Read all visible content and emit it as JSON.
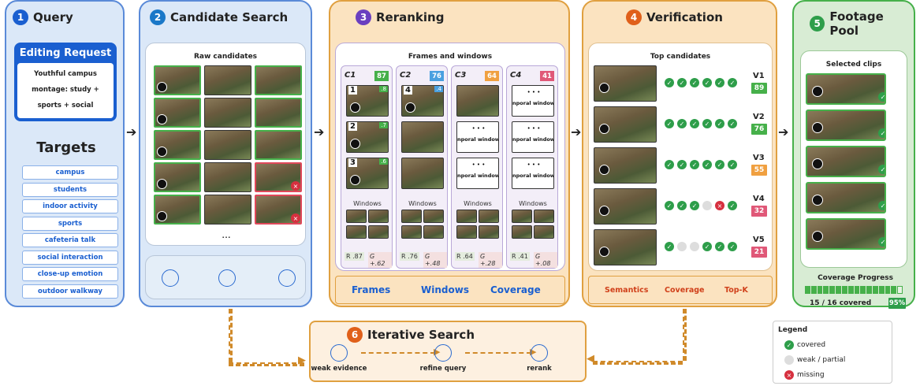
{
  "query": {
    "num": "1",
    "title": "Query",
    "editing_request_title": "Editing Request",
    "request_text": "Youthful campus montage: study + sports + social",
    "targets_title": "Targets",
    "targets": [
      "campus",
      "students",
      "indoor activity",
      "sports",
      "cafeteria talk",
      "social interaction",
      "close-up emotion",
      "outdoor walkway"
    ]
  },
  "candidate_search": {
    "num": "2",
    "title": "Candidate Search",
    "raw_title": "Raw candidates",
    "ellipsis": "..."
  },
  "reranking": {
    "num": "3",
    "title": "Reranking",
    "frames_title": "Frames and windows",
    "columns": [
      {
        "label": "C1",
        "score": "87",
        "color": "#46b04a",
        "frame_scores": [
          ".8",
          ".7",
          ".6"
        ],
        "frame_nums": [
          "1",
          "2",
          "3"
        ],
        "r": "R .87",
        "g": "G +.62"
      },
      {
        "label": "C2",
        "score": "76",
        "color": "#4aa0e0",
        "frame_scores": [
          ".4"
        ],
        "frame_nums": [
          "4"
        ],
        "r": "R .76",
        "g": "G +.48"
      },
      {
        "label": "C3",
        "score": "64",
        "color": "#f0a040",
        "frame_scores": [],
        "frame_nums": [],
        "r": "R .64",
        "g": "G +.28"
      },
      {
        "label": "C4",
        "score": "41",
        "color": "#e05878",
        "frame_scores": [],
        "frame_nums": [],
        "r": "R .41",
        "g": "G +.08"
      }
    ],
    "window_text": "nporal window",
    "windows_label": "Windows",
    "dots": "• • •",
    "bottom_labels": [
      "Frames",
      "Windows",
      "Coverage"
    ]
  },
  "verification": {
    "num": "4",
    "title": "Verification",
    "top_title": "Top candidates",
    "rows": [
      {
        "label": "V1",
        "score": "89",
        "color": "#46b04a",
        "checks": [
          "c",
          "c",
          "c",
          "c",
          "c",
          "c"
        ]
      },
      {
        "label": "V2",
        "score": "76",
        "color": "#46b04a",
        "checks": [
          "c",
          "c",
          "c",
          "c",
          "c",
          "c"
        ]
      },
      {
        "label": "V3",
        "score": "55",
        "color": "#f0a040",
        "checks": [
          "c",
          "c",
          "c",
          "c",
          "c",
          "c"
        ]
      },
      {
        "label": "V4",
        "score": "32",
        "color": "#e05878",
        "checks": [
          "c",
          "c",
          "c",
          "w",
          "m",
          "c"
        ]
      },
      {
        "label": "V5",
        "score": "21",
        "color": "#e05878",
        "checks": [
          "c",
          "w",
          "w",
          "c",
          "c",
          "c"
        ]
      }
    ],
    "bottom_labels": [
      "Semantics",
      "Coverage",
      "Top-K"
    ]
  },
  "footage_pool": {
    "num": "5",
    "title": "Footage Pool",
    "selected_title": "Selected clips",
    "coverage_title": "Coverage Progress",
    "covered_text": "15 / 16 covered",
    "percent": "95%",
    "progress_fraction": 0.9375
  },
  "iterative": {
    "num": "6",
    "title": "Iterative Search",
    "steps": [
      "weak evidence",
      "refine query",
      "rerank"
    ]
  },
  "legend": {
    "title": "Legend",
    "items": [
      "covered",
      "weak / partial",
      "missing"
    ]
  },
  "colors": {
    "blue": "#2a6ad0",
    "purple": "#6a3fc0",
    "orange": "#e0601a",
    "green": "#2e9e4a",
    "red": "#d6303f"
  }
}
